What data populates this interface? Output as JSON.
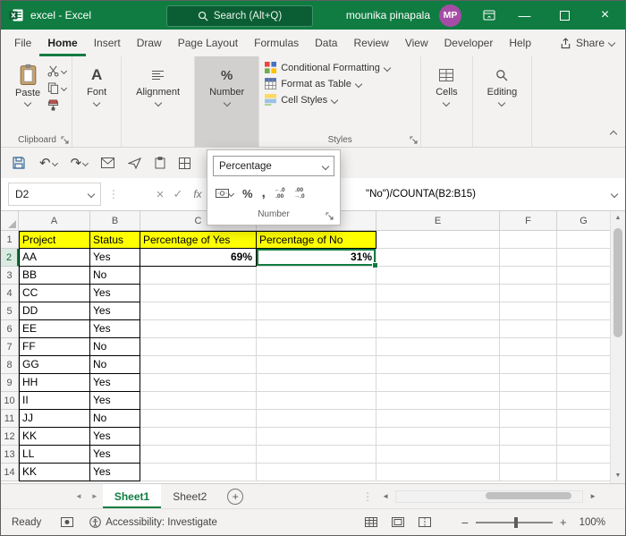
{
  "window": {
    "title": "excel - Excel"
  },
  "titlebar": {
    "search_placeholder": "Search (Alt+Q)",
    "user_name": "mounika pinapala",
    "user_initials": "MP"
  },
  "ribbon": {
    "tabs": [
      "File",
      "Home",
      "Insert",
      "Draw",
      "Page Layout",
      "Formulas",
      "Data",
      "Review",
      "View",
      "Developer",
      "Help"
    ],
    "active_tab": "Home",
    "share_label": "Share",
    "clipboard": {
      "paste_label": "Paste",
      "group_label": "Clipboard"
    },
    "font_group_label": "Font",
    "alignment_group_label": "Alignment",
    "number_group_label": "Number",
    "styles": {
      "conditional_formatting": "Conditional Formatting",
      "format_as_table": "Format as Table",
      "cell_styles": "Cell Styles",
      "group_label": "Styles"
    },
    "cells_group_label": "Cells",
    "editing_group_label": "Editing"
  },
  "number_popup": {
    "selected_format": "Percentage",
    "group_label": "Number"
  },
  "formula_bar": {
    "name_box": "D2",
    "fx_label": "fx",
    "visible_formula": "\"No\")/COUNTA(B2:B15)"
  },
  "sheet": {
    "col_headers": [
      "A",
      "B",
      "C",
      "D",
      "E",
      "F",
      "G"
    ],
    "active_cell": "D2",
    "active_row": "2",
    "rows": [
      {
        "n": "1",
        "a": "Project",
        "b": "Status",
        "c": "Percentage of Yes",
        "d": "Percentage of No"
      },
      {
        "n": "2",
        "a": "AA",
        "b": "Yes",
        "c": "69%",
        "d": "31%"
      },
      {
        "n": "3",
        "a": "BB",
        "b": "No"
      },
      {
        "n": "4",
        "a": "CC",
        "b": "Yes"
      },
      {
        "n": "5",
        "a": "DD",
        "b": "Yes"
      },
      {
        "n": "6",
        "a": "EE",
        "b": "Yes"
      },
      {
        "n": "7",
        "a": "FF",
        "b": "No"
      },
      {
        "n": "8",
        "a": "GG",
        "b": "No"
      },
      {
        "n": "9",
        "a": "HH",
        "b": "Yes"
      },
      {
        "n": "10",
        "a": "II",
        "b": "Yes"
      },
      {
        "n": "11",
        "a": "JJ",
        "b": "No"
      },
      {
        "n": "12",
        "a": "KK",
        "b": "Yes"
      },
      {
        "n": "13",
        "a": "LL",
        "b": "Yes"
      },
      {
        "n": "14",
        "a": "KK",
        "b": "Yes"
      }
    ]
  },
  "sheet_tabs": {
    "tabs": [
      "Sheet1",
      "Sheet2"
    ],
    "active": "Sheet1"
  },
  "status_bar": {
    "mode": "Ready",
    "accessibility": "Accessibility: Investigate",
    "zoom_level": "100%"
  },
  "colors": {
    "excel_green": "#107C41",
    "highlight_yellow": "#FFFF00",
    "selection_green": "#107C41",
    "avatar_purple": "#A64CA6"
  }
}
